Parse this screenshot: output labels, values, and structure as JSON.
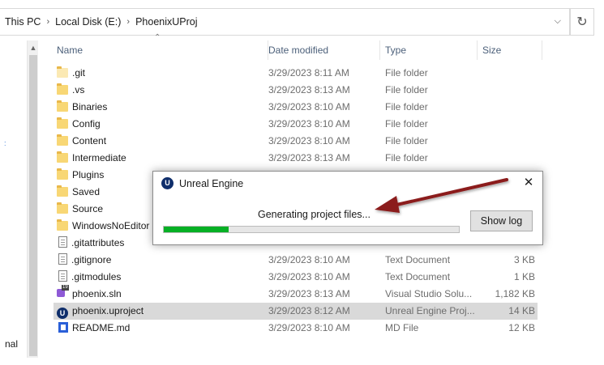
{
  "address": {
    "crumbs": [
      "This PC",
      "Local Disk (E:)",
      "PhoenixUProj"
    ],
    "dropdown_icon": "chevron-down-icon",
    "refresh_icon": "refresh-icon"
  },
  "nav": {
    "partial_label": "nal",
    "marker": ":"
  },
  "columns": {
    "name": "Name",
    "date": "Date modified",
    "type": "Type",
    "size": "Size"
  },
  "files": [
    {
      "name": ".git",
      "date": "3/29/2023 8:11 AM",
      "type": "File folder",
      "size": "",
      "icon": "folder-icon"
    },
    {
      "name": ".vs",
      "date": "3/29/2023 8:13 AM",
      "type": "File folder",
      "size": "",
      "icon": "folder-icon"
    },
    {
      "name": "Binaries",
      "date": "3/29/2023 8:10 AM",
      "type": "File folder",
      "size": "",
      "icon": "folder-icon"
    },
    {
      "name": "Config",
      "date": "3/29/2023 8:10 AM",
      "type": "File folder",
      "size": "",
      "icon": "folder-icon"
    },
    {
      "name": "Content",
      "date": "3/29/2023 8:10 AM",
      "type": "File folder",
      "size": "",
      "icon": "folder-icon"
    },
    {
      "name": "Intermediate",
      "date": "3/29/2023 8:13 AM",
      "type": "File folder",
      "size": "",
      "icon": "folder-icon"
    },
    {
      "name": "Plugins",
      "date": "",
      "type": "",
      "size": "",
      "icon": "folder-icon"
    },
    {
      "name": "Saved",
      "date": "",
      "type": "",
      "size": "",
      "icon": "folder-icon"
    },
    {
      "name": "Source",
      "date": "",
      "type": "",
      "size": "",
      "icon": "folder-icon"
    },
    {
      "name": "WindowsNoEditor",
      "date": "",
      "type": "",
      "size": "",
      "icon": "folder-icon"
    },
    {
      "name": ".gitattributes",
      "date": "",
      "type": "",
      "size": "",
      "icon": "document-icon"
    },
    {
      "name": ".gitignore",
      "date": "3/29/2023 8:10 AM",
      "type": "Text Document",
      "size": "3 KB",
      "icon": "document-icon"
    },
    {
      "name": ".gitmodules",
      "date": "3/29/2023 8:10 AM",
      "type": "Text Document",
      "size": "1 KB",
      "icon": "document-icon"
    },
    {
      "name": "phoenix.sln",
      "date": "3/29/2023 8:13 AM",
      "type": "Visual Studio Solu...",
      "size": "1,182 KB",
      "icon": "visual-studio-solution-icon"
    },
    {
      "name": "phoenix.uproject",
      "date": "3/29/2023 8:12 AM",
      "type": "Unreal Engine Proj...",
      "size": "14 KB",
      "icon": "unreal-engine-icon",
      "selected": true
    },
    {
      "name": "README.md",
      "date": "3/29/2023 8:10 AM",
      "type": "MD File",
      "size": "12 KB",
      "icon": "markdown-file-icon"
    }
  ],
  "dialog": {
    "title": "Unreal Engine",
    "status": "Generating project files...",
    "progress": 0.22,
    "button_label": "Show log",
    "icon": "unreal-engine-icon",
    "close_icon": "close-icon"
  },
  "colors": {
    "progress_fill": "#06b025",
    "annotation_arrow": "#8b1a1a",
    "selected_row": "#d9d9d9"
  }
}
